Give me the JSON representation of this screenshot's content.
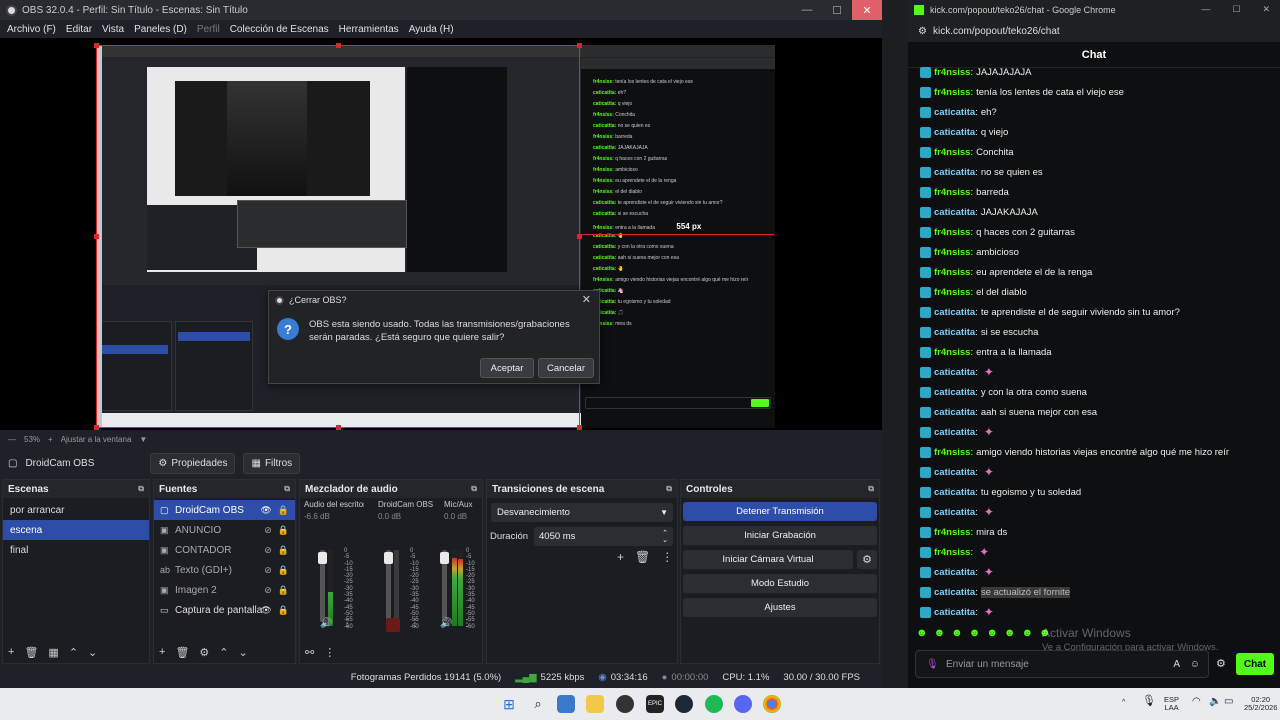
{
  "obs": {
    "title": "OBS 32.0.4 - Perfil: Sin Título - Escenas: Sin Título",
    "menu": [
      "Archivo (F)",
      "Editar",
      "Vista",
      "Paneles (D)",
      "Perfil",
      "Colección de Escenas",
      "Herramientas",
      "Ayuda (H)"
    ],
    "zoom": {
      "value": "53%",
      "fit_label": "Ajustar a la ventana"
    },
    "source_bar": {
      "source_name": "DroidCam OBS",
      "properties_label": "Propiedades",
      "filters_label": "Filtros"
    },
    "dialog": {
      "title": "¿Cerrar OBS?",
      "message": "OBS esta siendo usado. Todas las transmisiones/grabaciones serán paradas. ¿Está seguro que quiere salir?",
      "accept_label": "Aceptar",
      "cancel_label": "Cancelar"
    },
    "docks": {
      "scenes": {
        "title": "Escenas",
        "items": [
          "por arrancar",
          "escena",
          "final"
        ],
        "selected": 1
      },
      "sources": {
        "title": "Fuentes",
        "items": [
          {
            "label": "DroidCam OBS",
            "icon": "camera-icon"
          },
          {
            "label": "ANUNCIO",
            "icon": "image-icon"
          },
          {
            "label": "CONTADOR",
            "icon": "image-icon"
          },
          {
            "label": "Texto (GDI+)",
            "icon": "text-icon"
          },
          {
            "label": "Imagen 2",
            "icon": "image-icon"
          },
          {
            "label": "Captura de pantalla",
            "icon": "monitor-icon"
          }
        ],
        "selected": 0
      },
      "mixer": {
        "title": "Mezclador de audio",
        "channels": [
          {
            "name": "Audio del escritorio",
            "db": "-6.6 dB",
            "level": 0.45,
            "muted": false
          },
          {
            "name": "DroidCam OBS",
            "db": "0.0 dB",
            "level": 0.0,
            "muted": true
          },
          {
            "name": "Mic/Aux",
            "db": "0.0 dB",
            "level": 0.9,
            "muted": false
          }
        ],
        "scale": [
          "0",
          "-5",
          "-10",
          "-15",
          "-20",
          "-25",
          "-30",
          "-35",
          "-40",
          "-45",
          "-50",
          "-55",
          "-60"
        ]
      },
      "transitions": {
        "title": "Transiciones de escena",
        "transition": "Desvanecimiento",
        "duration_label": "Duración",
        "duration_value": "4050 ms"
      },
      "controls": {
        "title": "Controles",
        "buttons": [
          "Detener Transmisión",
          "Iniciar Grabación",
          "Iniciar Cámara Virtual",
          "Modo Estudio",
          "Ajustes"
        ]
      }
    },
    "status": {
      "dropped": "Fotogramas Perdidos 19141 (5.0%)",
      "bitrate": "5225 kbps",
      "stream_time": "03:34:16",
      "rec_time": "00:00:00",
      "cpu": "CPU: 1.1%",
      "fps": "30.00 / 30.00 FPS"
    }
  },
  "nested": {
    "size_label": "554 px"
  },
  "chrome": {
    "title": "kick.com/popout/teko26/chat - Google Chrome",
    "url": "kick.com/popout/teko26/chat",
    "chat_title": "Chat",
    "messages": [
      {
        "user": "fr4nsiss",
        "text": "JAJAJAJAJA",
        "color": "#53fc18"
      },
      {
        "user": "fr4nsiss",
        "text": "tenía los lentes de cata el viejo ese",
        "color": "#53fc18"
      },
      {
        "user": "caticatita",
        "text": "eh?",
        "color": "#7fd0ff"
      },
      {
        "user": "caticatita",
        "text": "q viejo",
        "color": "#7fd0ff"
      },
      {
        "user": "fr4nsiss",
        "text": "Conchita",
        "color": "#53fc18"
      },
      {
        "user": "caticatita",
        "text": "no se quien es",
        "color": "#7fd0ff"
      },
      {
        "user": "fr4nsiss",
        "text": "barreda",
        "color": "#53fc18"
      },
      {
        "user": "caticatita",
        "text": "JAJAKAJAJA",
        "color": "#7fd0ff"
      },
      {
        "user": "fr4nsiss",
        "text": "q haces con 2 guitarras",
        "color": "#53fc18"
      },
      {
        "user": "fr4nsiss",
        "text": "ambicioso",
        "color": "#53fc18"
      },
      {
        "user": "fr4nsiss",
        "text": "eu aprendete el de la renga",
        "color": "#53fc18"
      },
      {
        "user": "fr4nsiss",
        "text": "el del diablo",
        "color": "#53fc18"
      },
      {
        "user": "caticatita",
        "text": "te aprendiste el de seguir viviendo sin tu amor?",
        "color": "#7fd0ff"
      },
      {
        "user": "caticatita",
        "text": "si se escucha",
        "color": "#7fd0ff"
      },
      {
        "user": "fr4nsiss",
        "text": "entra a la llamada",
        "color": "#53fc18"
      },
      {
        "user": "caticatita",
        "text": "",
        "color": "#7fd0ff",
        "emote": "emote"
      },
      {
        "user": "caticatita",
        "text": "y con la otra como suena",
        "color": "#7fd0ff"
      },
      {
        "user": "caticatita",
        "text": "aah si suena mejor con esa",
        "color": "#7fd0ff"
      },
      {
        "user": "caticatita",
        "text": "",
        "color": "#7fd0ff",
        "emote": "emote"
      },
      {
        "user": "fr4nsiss",
        "text": "amigo viendo historias viejas encontré algo qué me hizo reír",
        "color": "#53fc18"
      },
      {
        "user": "caticatita",
        "text": "",
        "color": "#7fd0ff",
        "emote": "emote"
      },
      {
        "user": "caticatita",
        "text": "tu egoismo y tu soledad",
        "color": "#7fd0ff"
      },
      {
        "user": "caticatita",
        "text": "",
        "color": "#7fd0ff",
        "emote": "emote"
      },
      {
        "user": "fr4nsiss",
        "text": "mira ds",
        "color": "#53fc18"
      },
      {
        "user": "fr4nsiss",
        "text": "",
        "color": "#53fc18",
        "emote": "emote"
      },
      {
        "user": "caticatita",
        "text": "",
        "color": "#7fd0ff",
        "emote": "emote"
      },
      {
        "user": "caticatita",
        "text": "se actualizó el fornite",
        "color": "#7fd0ff"
      },
      {
        "user": "caticatita",
        "text": "",
        "color": "#7fd0ff",
        "emote": "emote"
      }
    ],
    "input_placeholder": "Enviar un mensaje",
    "send_label": "Chat",
    "watermark_1": "Activar Windows",
    "watermark_2": "Ve a Configuración para activar Windows."
  },
  "taskbar": {
    "lang_1": "ESP",
    "lang_2": "LAA",
    "time": "02:20",
    "date": "25/2/2026"
  }
}
